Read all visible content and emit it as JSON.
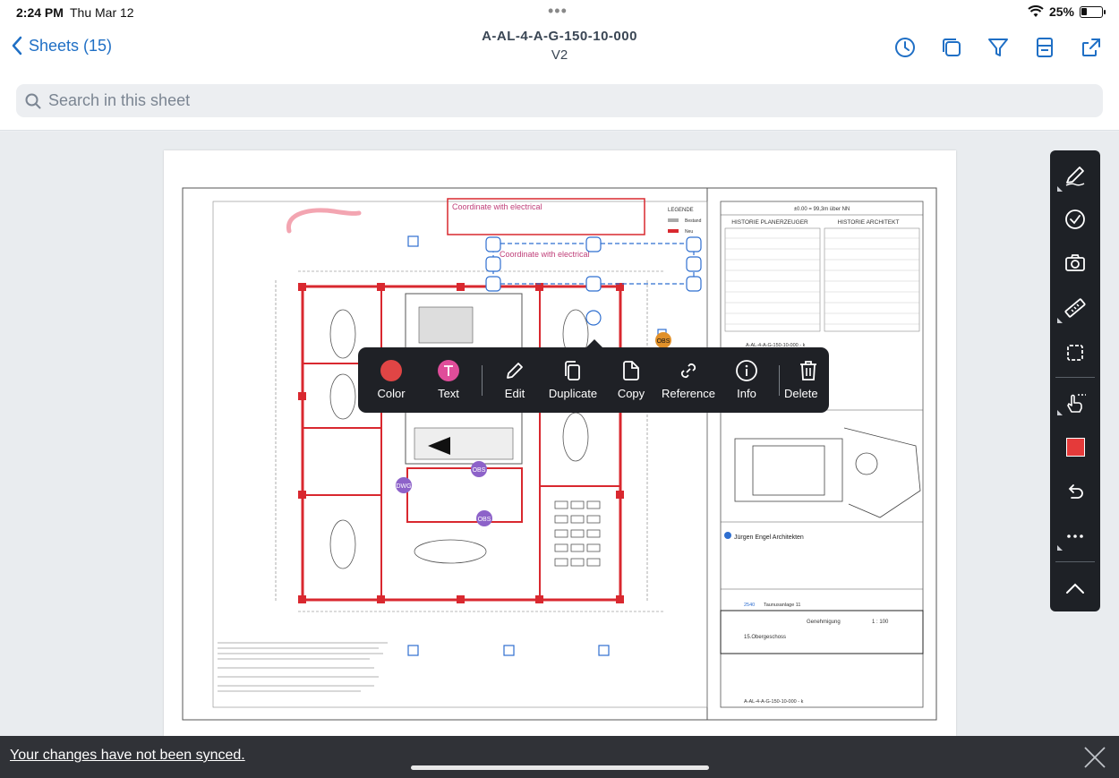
{
  "status": {
    "time": "2:24 PM",
    "date": "Thu Mar 12",
    "battery": "25%",
    "battery_level": 0.25,
    "icons": [
      "wifi-icon",
      "battery-icon"
    ]
  },
  "nav": {
    "back_label": "Sheets (15)",
    "title": "A-AL-4-A-G-150-10-000",
    "version": "V2",
    "icons": [
      "history-icon",
      "layers-icon",
      "filter-icon",
      "sheet-info-icon",
      "share-icon"
    ]
  },
  "search": {
    "placeholder": "Search in this sheet",
    "value": ""
  },
  "drawing": {
    "markup_text": "Coordinate with electrical",
    "legend_title": "LEGENDE",
    "legend_items": [
      "Bestand",
      "Neu"
    ],
    "elevation": "±0.00 = 99,3m über NN",
    "history_left": "HISTORIE PLANERZEUGER",
    "history_right": "HISTORIE ARCHITEKT",
    "sheet_code": "A-AL-4-A-G-150-10-000 - k",
    "architect": "Jürgen Engel Architekten",
    "project": "Taunusanlage 11",
    "project_no": "2540",
    "phase": "Genehmigung",
    "scale": "1 : 100",
    "floor": "15.Obergeschoss",
    "pins": [
      "OBS",
      "DWG",
      "OBS",
      "OBS"
    ],
    "colors": {
      "wall_red": "#d9282f",
      "markup_blue": "#2f6fd0",
      "pin_purple": "#8d62c9",
      "pin_orange": "#e0902a"
    }
  },
  "context_menu": {
    "items": [
      {
        "label": "Color",
        "icon": "color-dot-icon"
      },
      {
        "label": "Text",
        "icon": "text-icon"
      },
      {
        "label": "Edit",
        "icon": "pencil-icon"
      },
      {
        "label": "Duplicate",
        "icon": "duplicate-icon"
      },
      {
        "label": "Copy",
        "icon": "copy-icon"
      },
      {
        "label": "Reference",
        "icon": "link-icon"
      },
      {
        "label": "Info",
        "icon": "info-icon"
      },
      {
        "label": "Delete",
        "icon": "trash-icon"
      }
    ]
  },
  "toolbar": {
    "tools": [
      "pen-icon",
      "checkmark-icon",
      "camera-icon",
      "ruler-icon",
      "shape-icon",
      "hand-icon",
      "color-swatch",
      "undo-icon",
      "more-icon",
      "collapse-chevron-icon"
    ],
    "active_color": "#e53a3a"
  },
  "sync": {
    "message": "Your changes have not been synced."
  }
}
